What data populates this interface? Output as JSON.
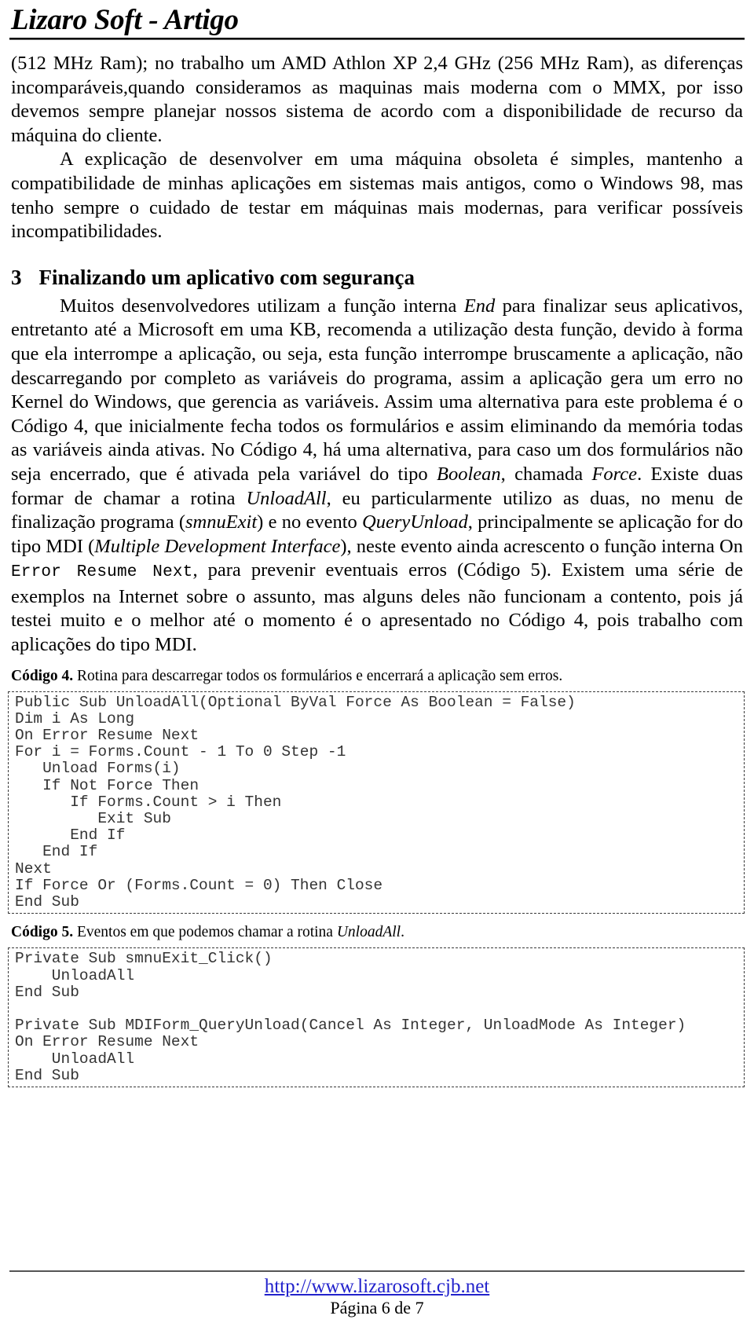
{
  "header": {
    "title": "Lizaro Soft - Artigo"
  },
  "body": {
    "para1_part1": "(512 MHz Ram); no trabalho um AMD Athlon XP 2,4 GHz (256 MHz Ram), as diferenças incomparáveis,quando consideramos as maquinas mais moderna com o MMX, por isso devemos sempre planejar nossos sistema de acordo com a disponibilidade de recurso da máquina do cliente.",
    "para2": "A explicação de desenvolver em uma máquina obsoleta é simples, mantenho a compatibilidade de minhas aplicações em sistemas mais antigos, como o Windows 98, mas tenho sempre o cuidado de testar em máquinas mais modernas, para verificar possíveis incompatibilidades."
  },
  "section": {
    "number": "3",
    "title": "Finalizando um aplicativo com segurança"
  },
  "para3": {
    "s1": "Muitos desenvolvedores utilizam a função interna ",
    "i1": "End",
    "s2": " para finalizar seus aplicativos, entretanto até a Microsoft em uma KB, recomenda a utilização desta função, devido à forma que ela interrompe a aplicação, ou seja, esta função interrompe bruscamente a aplicação, não descarregando por completo as variáveis do programa, assim a aplicação gera um erro no Kernel do Windows, que gerencia as variáveis. Assim uma alternativa para este problema é o Código 4, que inicialmente fecha todos os formulários e assim eliminando da memória todas as variáveis ainda ativas. No Código 4, há uma alternativa, para caso um dos formulários não seja encerrado, que é ativada pela variável do tipo ",
    "i2": "Boolean",
    "s3": ", chamada ",
    "i3": "Force",
    "s4": ". Existe duas formar de chamar a rotina ",
    "i4": "UnloadAll",
    "s5": ", eu particularmente utilizo as duas, no menu de finalização programa (",
    "i5": "smnuExit",
    "s6": ") e no evento ",
    "i6": "QueryUnload",
    "s7": ", principalmente se aplicação for do tipo MDI (",
    "i7": "Multiple Development Interface",
    "s8": "), neste evento ainda acrescento o função interna On ",
    "m1": "Error Resume Next",
    "s9": ", para prevenir eventuais erros (Código 5). Existem uma série de exemplos na Internet sobre o assunto, mas alguns deles não funcionam a contento, pois já testei muito e o melhor até o momento é o apresentado no Código 4, pois trabalho com aplicações do tipo MDI."
  },
  "codigo4": {
    "caption_bold": "Código 4.",
    "caption_rest": " Rotina para descarregar todos os formulários e encerrará a aplicação sem erros.",
    "code": "Public Sub UnloadAll(Optional ByVal Force As Boolean = False)\nDim i As Long\nOn Error Resume Next\nFor i = Forms.Count - 1 To 0 Step -1\n   Unload Forms(i)\n   If Not Force Then\n      If Forms.Count > i Then\n         Exit Sub\n      End If\n   End If\nNext\nIf Force Or (Forms.Count = 0) Then Close\nEnd Sub"
  },
  "codigo5": {
    "caption_bold": "Código 5.",
    "caption_rest_1": " Eventos em que podemos chamar a rotina ",
    "caption_italic": "UnloadAll",
    "caption_rest_2": ".",
    "code": "Private Sub smnuExit_Click()\n    UnloadAll\nEnd Sub\n\nPrivate Sub MDIForm_QueryUnload(Cancel As Integer, UnloadMode As Integer)\nOn Error Resume Next\n    UnloadAll\nEnd Sub"
  },
  "footer": {
    "url": "http://www.lizarosoft.cjb.net",
    "page": "Página 6 de 7",
    "link_color": "#2222cc"
  }
}
